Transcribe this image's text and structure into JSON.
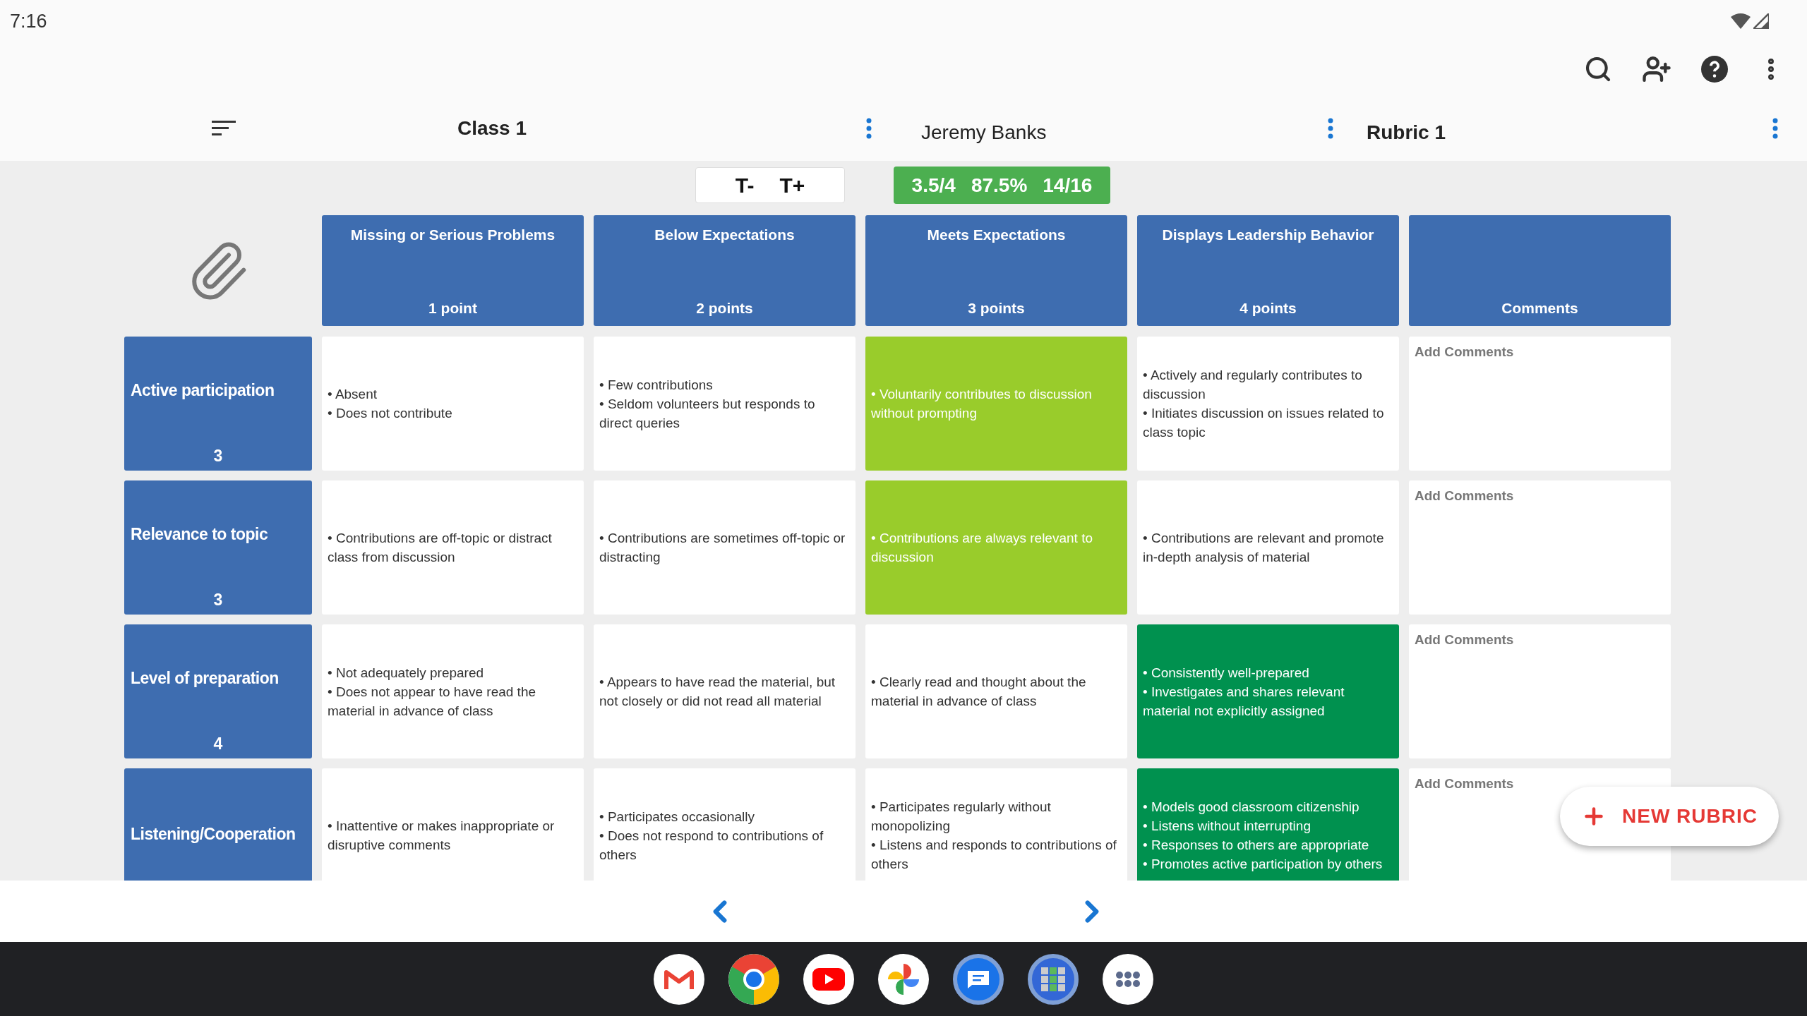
{
  "status_bar": {
    "time": "7:16"
  },
  "toolbar": {
    "class_name": "Class 1",
    "student": "Jeremy Banks",
    "rubric": "Rubric 1"
  },
  "text_size": {
    "decrease": "T-",
    "increase": "T+"
  },
  "score": {
    "points": "3.5/4",
    "percent": "87.5%",
    "total": "14/16"
  },
  "columns": [
    {
      "kind": "level",
      "title": "Missing or Serious Problems",
      "points": "1 point"
    },
    {
      "kind": "level",
      "title": "Below Expectations",
      "points": "2 points"
    },
    {
      "kind": "level",
      "title": "Meets Expectations",
      "points": "3 points"
    },
    {
      "kind": "level",
      "title": "Displays Leadership Behavior",
      "points": "4 points"
    },
    {
      "kind": "comments",
      "title": "Comments"
    }
  ],
  "criteria": [
    {
      "name": "Active participation",
      "score": "3",
      "comment_placeholder": "Add Comments",
      "cells": [
        {
          "lines": [
            "• Absent",
            "• Does not contribute"
          ],
          "selected": false
        },
        {
          "lines": [
            "• Few contributions",
            "• Seldom volunteers but responds to direct queries"
          ],
          "selected": false
        },
        {
          "lines": [
            "• Voluntarily contributes to discussion without prompting"
          ],
          "selected": true
        },
        {
          "lines": [
            "• Actively and regularly contributes to discussion",
            "• Initiates discussion on issues related to class topic"
          ],
          "selected": false
        }
      ]
    },
    {
      "name": "Relevance to topic",
      "score": "3",
      "comment_placeholder": "Add Comments",
      "cells": [
        {
          "lines": [
            "• Contributions are off-topic or distract class from discussion"
          ],
          "selected": false
        },
        {
          "lines": [
            "• Contributions are sometimes off-topic or distracting"
          ],
          "selected": false
        },
        {
          "lines": [
            "• Contributions are always relevant to discussion"
          ],
          "selected": true
        },
        {
          "lines": [
            "• Contributions are relevant and promote in-depth analysis of material"
          ],
          "selected": false
        }
      ]
    },
    {
      "name": "Level of preparation",
      "score": "4",
      "comment_placeholder": "Add Comments",
      "cells": [
        {
          "lines": [
            "• Not adequately prepared",
            "• Does not appear to have read the material in advance of class"
          ],
          "selected": false
        },
        {
          "lines": [
            "• Appears to have read the material, but not closely or did not read all material"
          ],
          "selected": false
        },
        {
          "lines": [
            "• Clearly read and thought about the material in advance of class"
          ],
          "selected": false
        },
        {
          "lines": [
            "• Consistently well-prepared",
            "• Investigates and shares relevant material not explicitly assigned"
          ],
          "selected": true
        }
      ]
    },
    {
      "name": "Listening/Cooperation",
      "comment_placeholder": "Add Comments",
      "cells": [
        {
          "lines": [
            "• Inattentive or makes inappropriate or disruptive comments"
          ],
          "selected": false
        },
        {
          "lines": [
            "• Participates occasionally",
            "• Does not respond to contributions of others"
          ],
          "selected": false
        },
        {
          "lines": [
            "• Participates regularly without monopolizing",
            "• Listens and responds to contributions of others"
          ],
          "selected": false
        },
        {
          "lines": [
            "• Models good classroom citizenship",
            "• Listens without interrupting",
            "• Responses to others are appropriate",
            "• Promotes active participation by others"
          ],
          "selected": true
        }
      ]
    }
  ],
  "fab": {
    "label": "NEW RUBRIC"
  }
}
